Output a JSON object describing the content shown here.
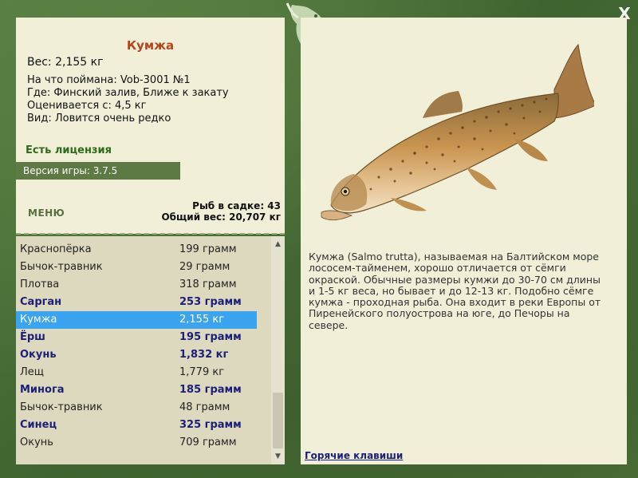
{
  "window": {
    "close_label": "X"
  },
  "fish": {
    "title": "Кумжа",
    "weight": "Вес: 2,155 кг",
    "caught_on": "На что поймана: Vob-3001 №1",
    "where": "Где: Финский залив, Ближе к закату",
    "valued_from": "Оценивается с: 4,5 кг",
    "kind": "Вид: Ловится очень редко",
    "license": "Есть лицензия",
    "description": "Кумжа (Salmo trutta), называемая на Балтийском море лососем-тайменем, хорошо отличается от сёмги окраской. Обычные размеры кумжи до 30-70 см длины и 1-5 кг веса, но бывает и до 12-13 кг. Подобно сёмге кумжа - проходная рыба. Она входит в реки Европы от Пиренейского полуострова на юге, до Печоры на севере."
  },
  "version": "Версия игры: 3.7.5",
  "menu_label": "МЕНЮ",
  "stats": {
    "count": "Рыб в садке: 43",
    "total": "Общий вес: 20,707 кг"
  },
  "catch_list": [
    {
      "name": "Краснопёрка",
      "weight": "199 грамм",
      "bold": false,
      "selected": false
    },
    {
      "name": "Бычок-травник",
      "weight": "29 грамм",
      "bold": false,
      "selected": false
    },
    {
      "name": "Плотва",
      "weight": "318 грамм",
      "bold": false,
      "selected": false
    },
    {
      "name": "Сарган",
      "weight": "253 грамм",
      "bold": true,
      "selected": false
    },
    {
      "name": "Кумжа",
      "weight": "2,155 кг",
      "bold": false,
      "selected": true
    },
    {
      "name": "Ёрш",
      "weight": "195 грамм",
      "bold": true,
      "selected": false
    },
    {
      "name": "Окунь",
      "weight": "1,832 кг",
      "bold": true,
      "selected": false
    },
    {
      "name": "Лещ",
      "weight": "1,779 кг",
      "bold": false,
      "selected": false
    },
    {
      "name": "Минога",
      "weight": "185 грамм",
      "bold": true,
      "selected": false
    },
    {
      "name": "Бычок-травник",
      "weight": "48 грамм",
      "bold": false,
      "selected": false
    },
    {
      "name": "Синец",
      "weight": "325 грамм",
      "bold": true,
      "selected": false
    },
    {
      "name": "Окунь",
      "weight": "709 грамм",
      "bold": false,
      "selected": false
    }
  ],
  "hotkeys_label": "Горячие клавиши",
  "icons": {
    "close": "close-icon",
    "emblem": "fish-emblem-icon",
    "scroll_up": "chevron-up-icon",
    "scroll_down": "chevron-down-icon"
  },
  "colors": {
    "title": "#b5451b",
    "license": "#2d6a1a",
    "selected_row": "#3ba4f0",
    "bold_row": "#1c1f7a",
    "panel": "#f2efd9"
  }
}
